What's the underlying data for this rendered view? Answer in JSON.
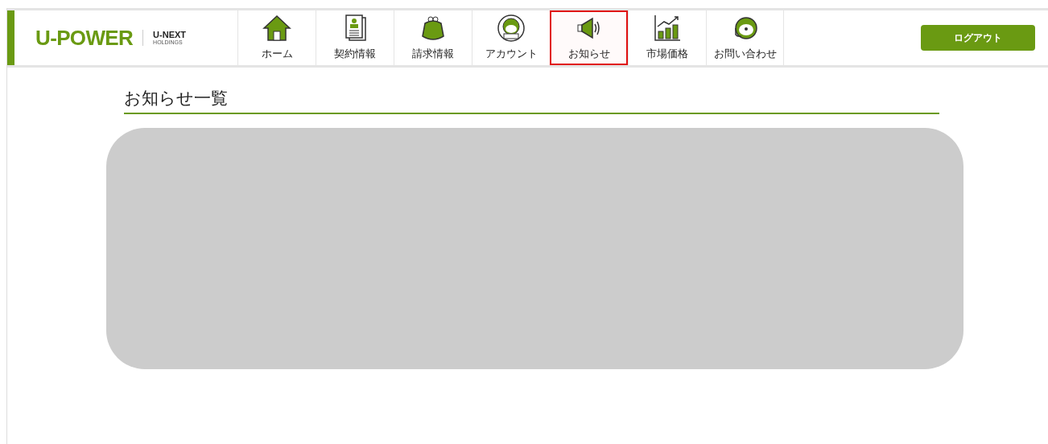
{
  "header": {
    "brand": "U-POWER",
    "partner_top": "U-NEXT",
    "partner_bottom": "HOLDINGS",
    "logout": "ログアウト"
  },
  "nav": [
    {
      "kind": "home",
      "label": "ホーム",
      "selected": false
    },
    {
      "kind": "contract",
      "label": "契約情報",
      "selected": false
    },
    {
      "kind": "billing",
      "label": "請求情報",
      "selected": false
    },
    {
      "kind": "account",
      "label": "アカウント",
      "selected": false
    },
    {
      "kind": "news",
      "label": "お知らせ",
      "selected": true
    },
    {
      "kind": "market",
      "label": "市場価格",
      "selected": false
    },
    {
      "kind": "contact",
      "label": "お問い合わせ",
      "selected": false
    }
  ],
  "page_title": "お知らせ一覧"
}
